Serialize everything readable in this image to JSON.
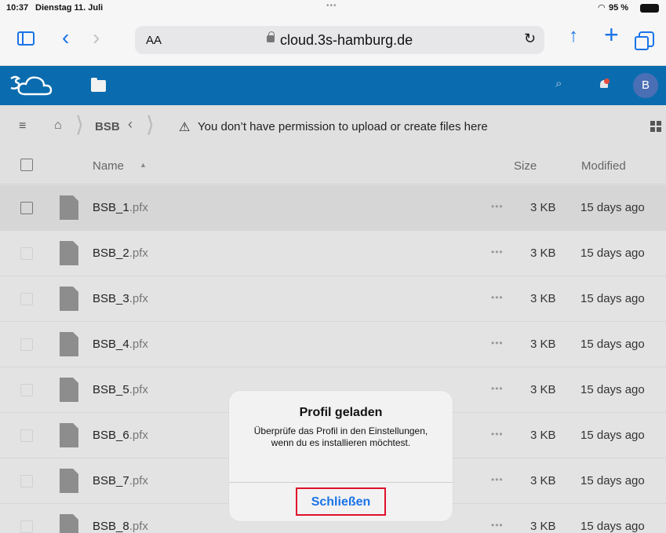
{
  "status_bar": {
    "time": "10:37",
    "date": "Dienstag 11. Juli",
    "dots": "•••",
    "battery": "95 %"
  },
  "safari": {
    "text_size_label": "AA",
    "url": "cloud.3s-hamburg.de"
  },
  "nextcloud_header": {
    "avatar_initial": "B",
    "accent": "#0a6cae"
  },
  "controls": {
    "breadcrumb_folder": "BSB",
    "warning_text": "You don’t have permission to upload or create files here"
  },
  "table": {
    "headers": {
      "name": "Name",
      "size": "Size",
      "modified": "Modified"
    },
    "rows": [
      {
        "name": "BSB_1",
        "ext": ".pfx",
        "size": "3 KB",
        "modified": "15 days ago"
      },
      {
        "name": "BSB_2",
        "ext": ".pfx",
        "size": "3 KB",
        "modified": "15 days ago"
      },
      {
        "name": "BSB_3",
        "ext": ".pfx",
        "size": "3 KB",
        "modified": "15 days ago"
      },
      {
        "name": "BSB_4",
        "ext": ".pfx",
        "size": "3 KB",
        "modified": "15 days ago"
      },
      {
        "name": "BSB_5",
        "ext": ".pfx",
        "size": "3 KB",
        "modified": "15 days ago"
      },
      {
        "name": "BSB_6",
        "ext": ".pfx",
        "size": "3 KB",
        "modified": "15 days ago"
      },
      {
        "name": "BSB_7",
        "ext": ".pfx",
        "size": "3 KB",
        "modified": "15 days ago"
      },
      {
        "name": "BSB_8",
        "ext": ".pfx",
        "size": "3 KB",
        "modified": "15 days ago"
      }
    ]
  },
  "alert": {
    "title": "Profil geladen",
    "message": "Überprüfe das Profil in den Einstellungen, wenn du es installieren möchtest.",
    "button": "Schließen"
  }
}
